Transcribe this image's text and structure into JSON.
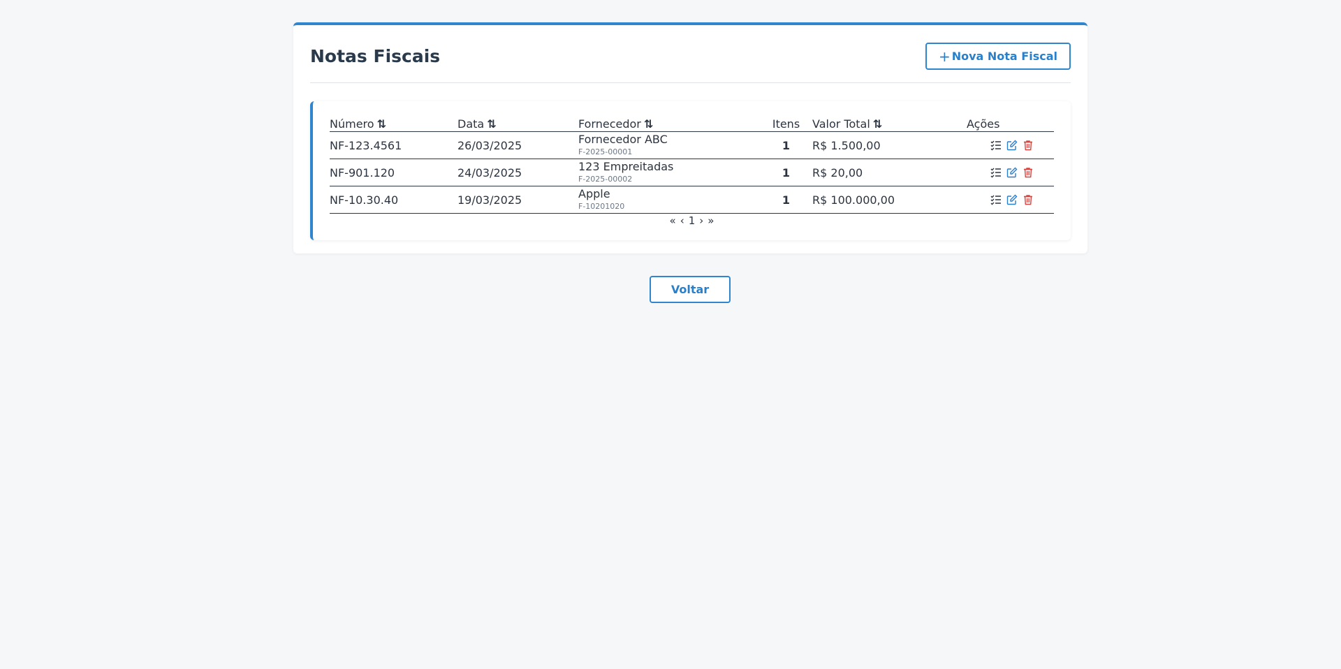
{
  "header": {
    "title": "Notas Fiscais",
    "new_button_plus": "+",
    "new_button_label": "Nova Nota Fiscal"
  },
  "table": {
    "columns": {
      "numero": "Número",
      "data": "Data",
      "fornecedor": "Fornecedor",
      "itens": "Itens",
      "valor_total": "Valor Total",
      "acoes": "Ações"
    },
    "sort_icon": "⇅",
    "rows": [
      {
        "numero": "NF-123.4561",
        "data": "26/03/2025",
        "fornecedor": "Fornecedor ABC",
        "fornecedor_codigo": "F-2025-00001",
        "itens": "1",
        "valor_total": "R$ 1.500,00"
      },
      {
        "numero": "NF-901.120",
        "data": "24/03/2025",
        "fornecedor": "123 Empreitadas",
        "fornecedor_codigo": "F-2025-00002",
        "itens": "1",
        "valor_total": "R$ 20,00"
      },
      {
        "numero": "NF-10.30.40",
        "data": "19/03/2025",
        "fornecedor": "Apple",
        "fornecedor_codigo": "F-10201020",
        "itens": "1",
        "valor_total": "R$ 100.000,00"
      }
    ],
    "action_icons": [
      "list-check-icon",
      "edit-icon",
      "trash-icon"
    ],
    "colors": {
      "accent": "#3085cf",
      "edit": "#2a7fcb",
      "delete": "#d9433f",
      "list": "#2c3440"
    }
  },
  "pagination": {
    "first": "«",
    "prev": "‹",
    "current_page": "1",
    "next": "›",
    "last": "»"
  },
  "footer": {
    "back_label": "Voltar"
  }
}
